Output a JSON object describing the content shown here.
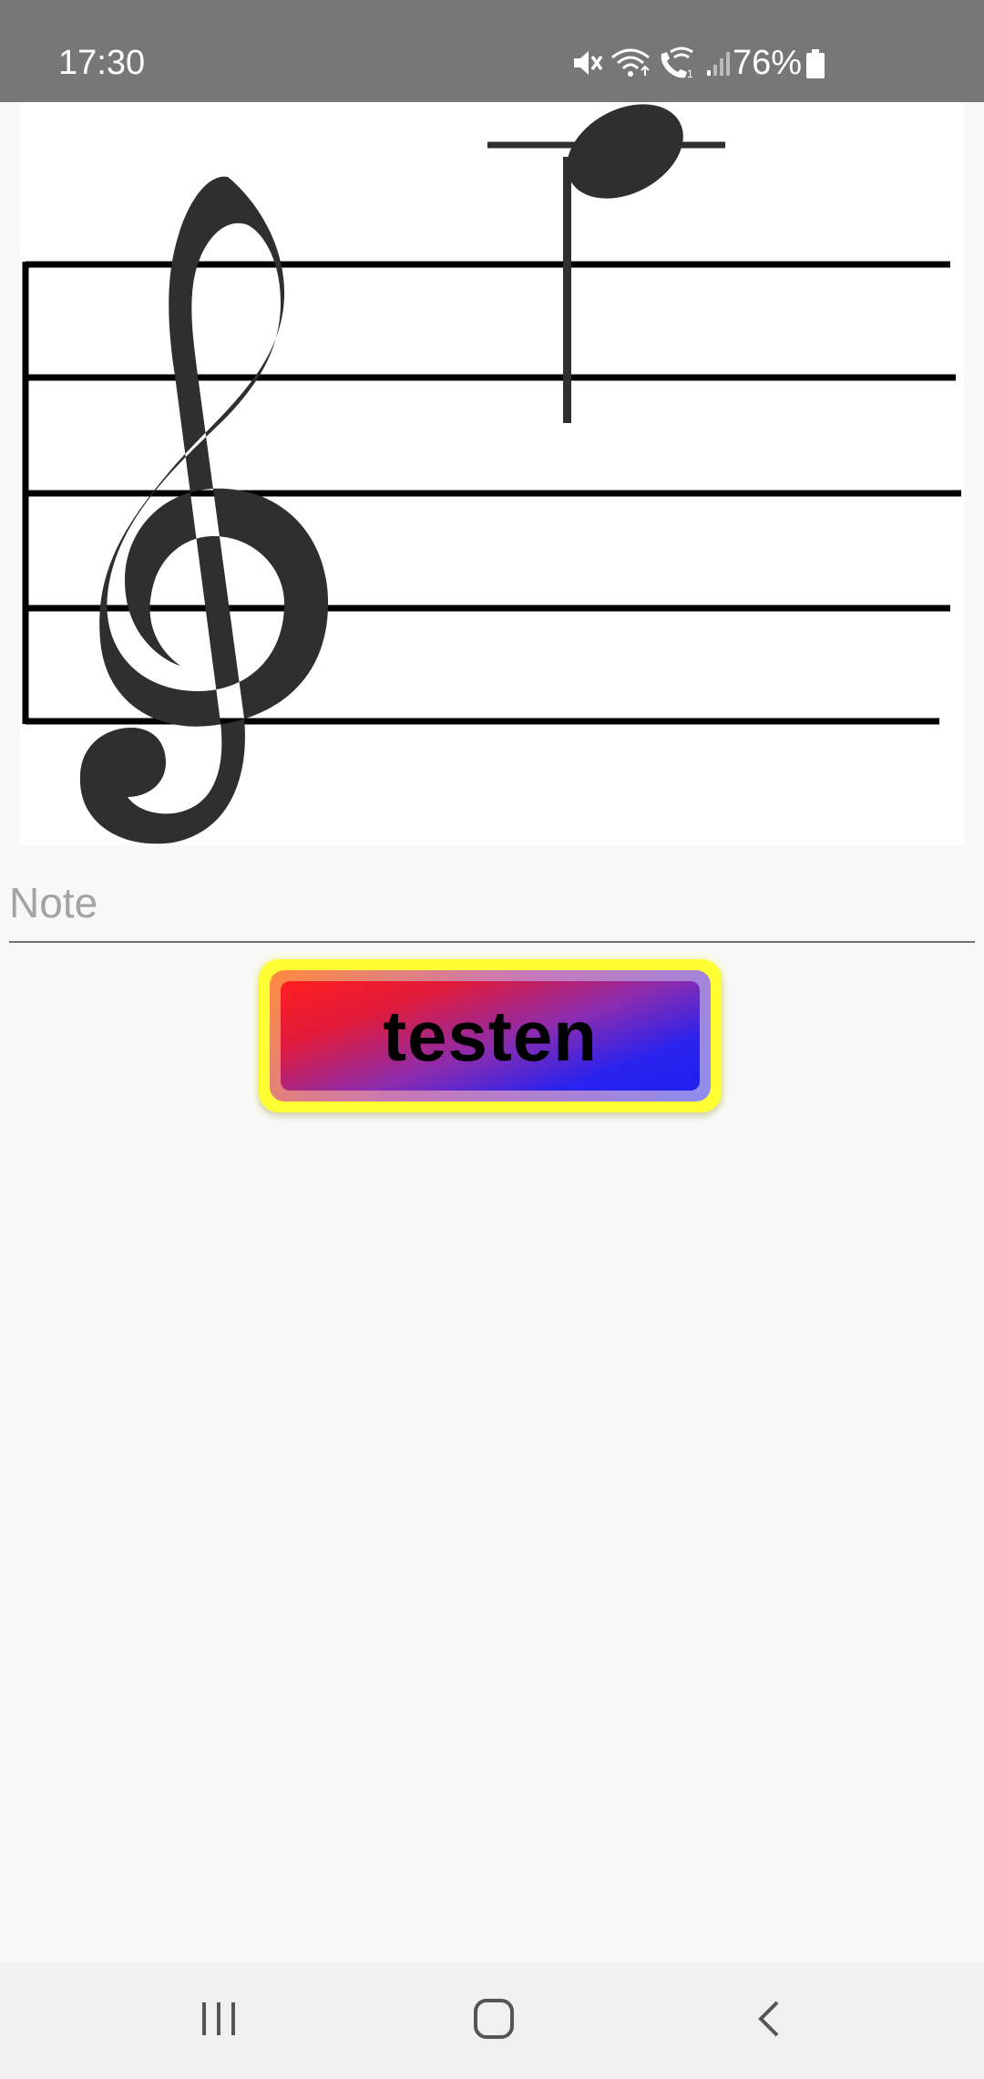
{
  "status_bar": {
    "time": "17:30",
    "battery": "76%",
    "icons": [
      "mute-icon",
      "wifi-icon",
      "wifi-calling-icon",
      "signal-icon",
      "battery-icon"
    ]
  },
  "notation": {
    "clef": "treble-clef",
    "note": "quarter-note"
  },
  "note_input": {
    "placeholder": "Note",
    "value": ""
  },
  "test_button": {
    "label": "testen"
  },
  "nav": {
    "recents": "recents-icon",
    "home": "home-icon",
    "back": "back-icon"
  },
  "colors": {
    "status_bar": "#777777",
    "background": "#f8f8f8",
    "button_border": "#ffff33",
    "button_top": "#ff1f1f",
    "button_bottom": "#2020ee"
  }
}
